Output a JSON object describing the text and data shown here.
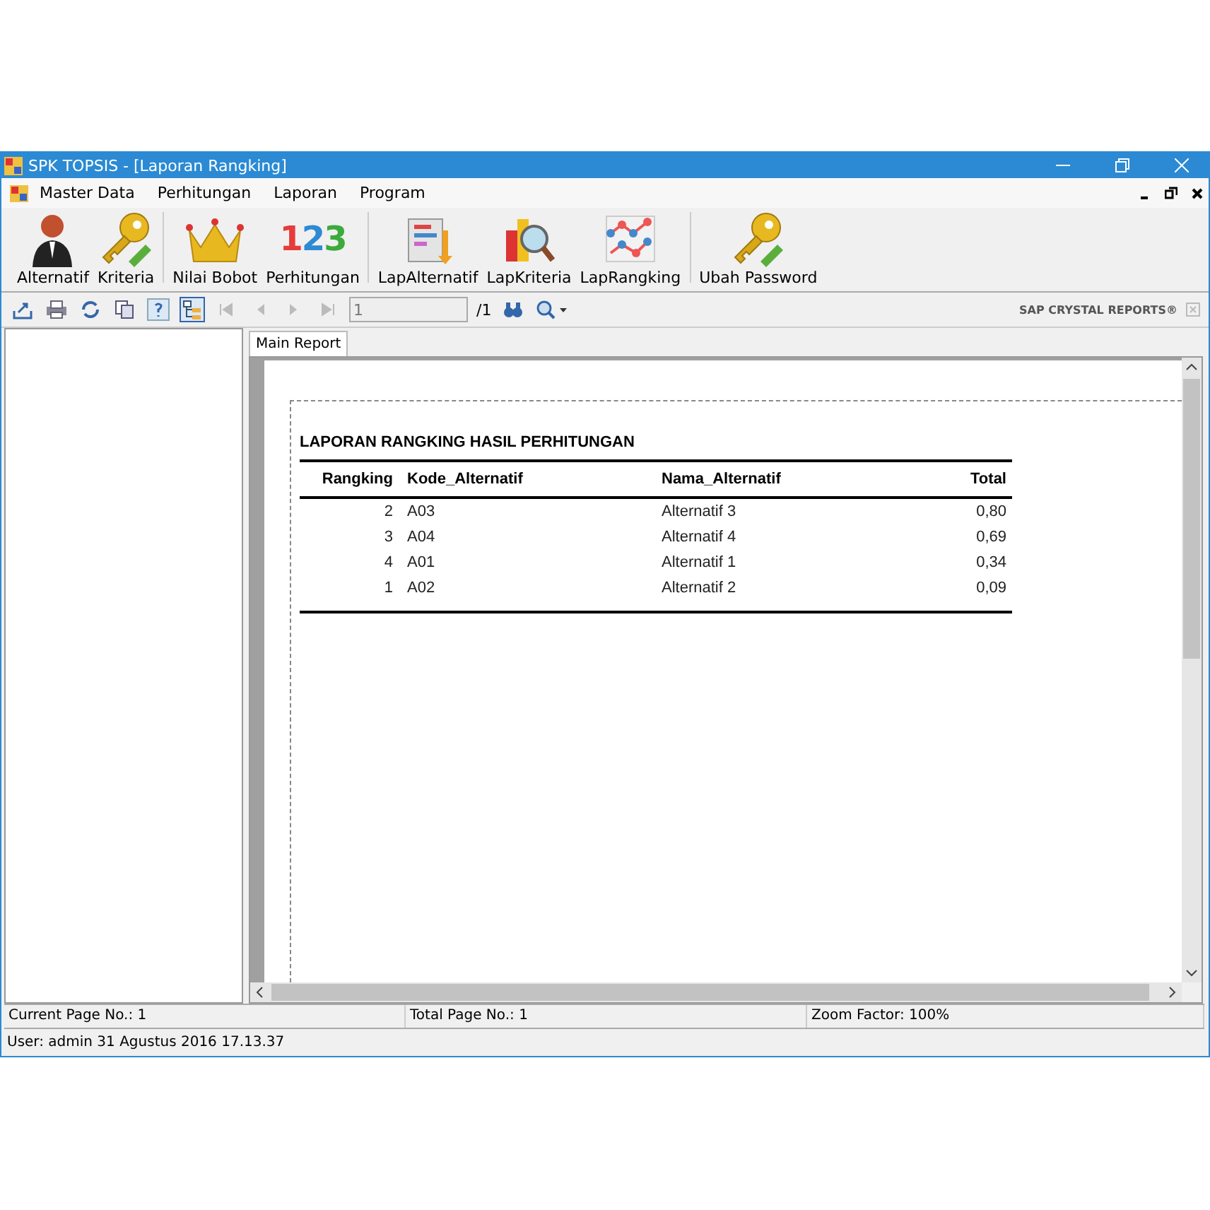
{
  "window": {
    "title": "SPK TOPSIS - [Laporan Rangking]"
  },
  "menu": [
    "Master Data",
    "Perhitungan",
    "Laporan",
    "Program"
  ],
  "toolbar": [
    {
      "label": "Alternatif",
      "kind": "person"
    },
    {
      "label": "Kriteria",
      "kind": "key"
    },
    {
      "label": "Nilai Bobot",
      "kind": "crown"
    },
    {
      "label": "Perhitungan",
      "kind": "digits",
      "glyph": "123"
    },
    {
      "label": "LapAlternatif",
      "kind": "bars"
    },
    {
      "label": "LapKriteria",
      "kind": "magnifier"
    },
    {
      "label": "LapRangking",
      "kind": "network"
    },
    {
      "label": "Ubah Password",
      "kind": "key"
    }
  ],
  "viewer": {
    "page_field": "1",
    "page_total": "/1",
    "brand": "SAP CRYSTAL REPORTS®"
  },
  "tabs": [
    {
      "label": "Main Report",
      "selected": true
    }
  ],
  "report": {
    "title": "LAPORAN RANGKING HASIL PERHITUNGAN",
    "columns": [
      "Rangking",
      "Kode_Alternatif",
      "Nama_Alternatif",
      "Total"
    ],
    "rows": [
      [
        "2",
        "A03",
        "Alternatif 3",
        "0,80"
      ],
      [
        "3",
        "A04",
        "Alternatif 4",
        "0,69"
      ],
      [
        "4",
        "A01",
        "Alternatif 1",
        "0,34"
      ],
      [
        "1",
        "A02",
        "Alternatif 2",
        "0,09"
      ]
    ]
  },
  "status_bar": [
    "Current Page No.: 1",
    "Total Page No.: 1",
    "Zoom Factor: 100%"
  ],
  "footer": "User: admin  31 Agustus 2016 17.13.37"
}
